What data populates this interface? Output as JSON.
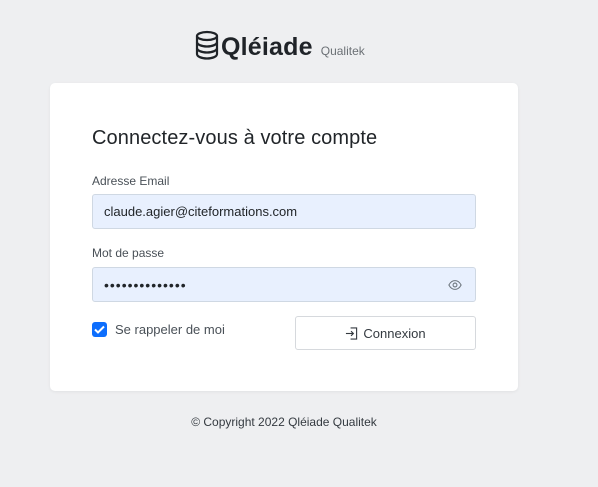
{
  "brand": {
    "name": "Qléiade",
    "subtitle": "Qualitek",
    "icon": "database-icon"
  },
  "login": {
    "title": "Connectez-vous à votre compte",
    "email_label": "Adresse Email",
    "email_value": "claude.agier@citeformations.com",
    "password_label": "Mot de passe",
    "password_value": "••••••••••••••",
    "password_toggle_icon": "eye-icon",
    "remember_label": "Se rappeler de moi",
    "remember_checked": true,
    "submit_label": "Connexion",
    "submit_icon": "login-icon"
  },
  "footer": {
    "copyright": "© Copyright 2022 Qléiade Qualitek"
  },
  "colors": {
    "background": "#eeeff1",
    "card": "#ffffff",
    "input_fill": "#e8f0fe",
    "checkbox_accent": "#0d6efd"
  }
}
